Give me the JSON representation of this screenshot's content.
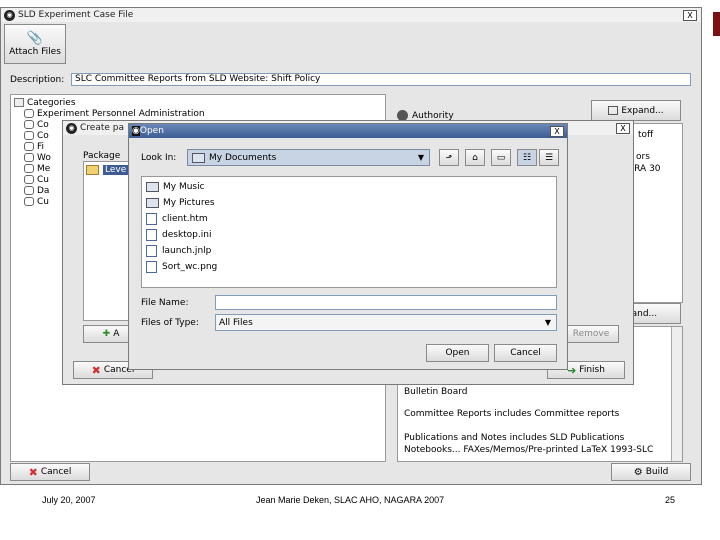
{
  "main_window": {
    "title": "SLD Experiment Case File",
    "close_label": "X",
    "attach_files_label": "Attach Files",
    "description_label": "Description:",
    "description_value": "SLC Committee Reports from SLD Website: Shift Policy",
    "categories_root": "Categories",
    "tree_items": [
      "Experiment Personnel Administration",
      "Co",
      "Co",
      "Fi",
      "Wo",
      "Me",
      "Cu",
      "Da",
      "Cu"
    ],
    "authority_label": "Authority",
    "expand_label": "Expand...",
    "expand_label_2": "Expand...",
    "right_text_1": "toff",
    "right_text_2": "ors",
    "right_text_3": "ARA 30",
    "list_items": [
      "Bulletin Board",
      "Committee Reports includes Committee reports",
      "Publications and Notes includes SLD Publications"
    ],
    "list_item_partial": "Notebooks... FAXes/Memos/Pre-printed LaTeX 1993-SLC...",
    "cancel_label": "Cancel",
    "build_label": "Build"
  },
  "create_window": {
    "title": "Create pa",
    "package_label": "Package",
    "tree_item": "Leve",
    "add_label": "A",
    "cancel_label": "Cancel",
    "finish_label": "Finish",
    "remove_label": "Remove",
    "close_label": "X"
  },
  "open_dialog": {
    "title": "Open",
    "close_label": "X",
    "look_in_label": "Look In:",
    "look_in_value": "My Documents",
    "folders": [
      "My Music",
      "My Pictures"
    ],
    "files": [
      "client.htm",
      "desktop.ini",
      "launch.jnlp",
      "Sort_wc.png"
    ],
    "file_name_label": "File Name:",
    "file_name_value": "",
    "files_of_type_label": "Files of Type:",
    "files_of_type_value": "All Files",
    "open_label": "Open",
    "cancel_label": "Cancel"
  },
  "footer": {
    "date": "July 20, 2007",
    "author": "Jean Marie Deken, SLAC AHO, NAGARA 2007",
    "page": "25"
  },
  "colors": {
    "cancel_icon": "#d03030",
    "finish_icon": "#2a8a2a",
    "dialog_titlebar": "#3d5c93"
  }
}
